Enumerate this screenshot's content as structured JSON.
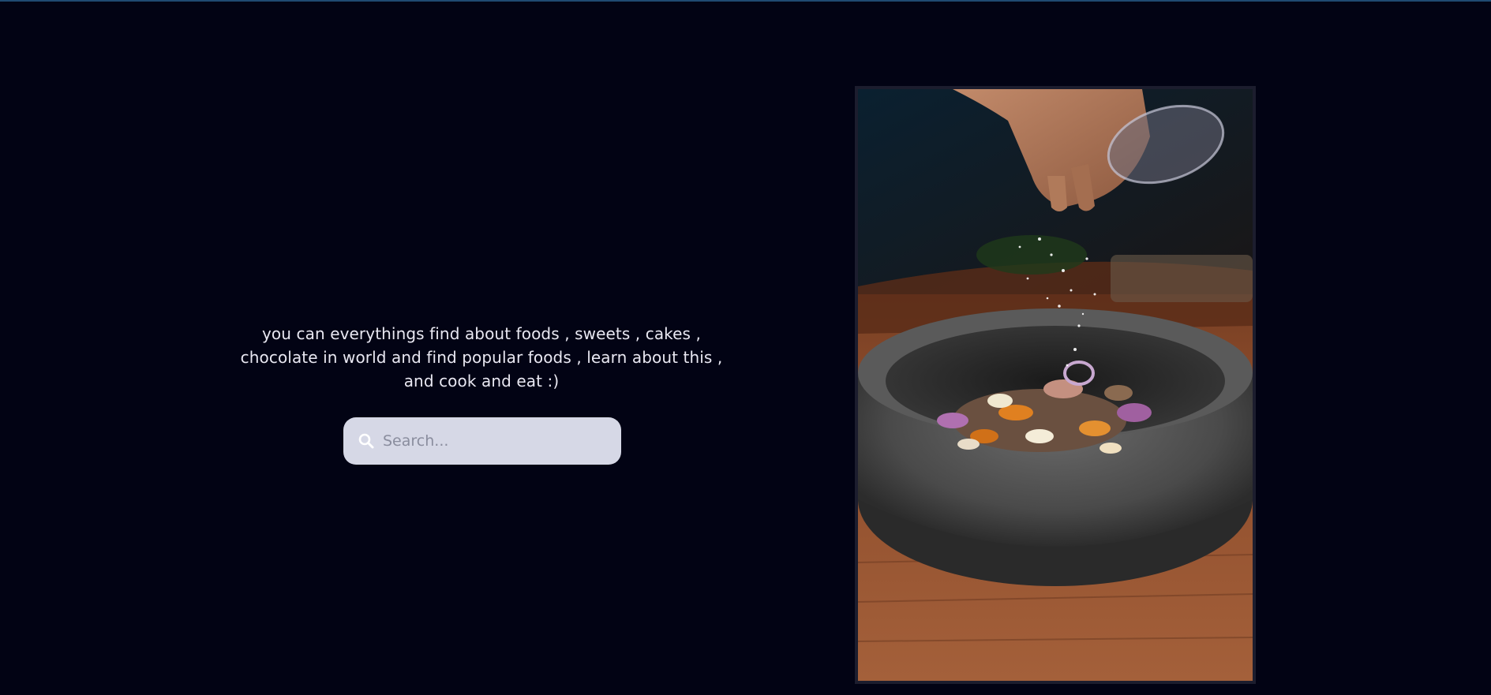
{
  "hero": {
    "description": "you can everythings find about foods , sweets , cakes , chocolate in world and find popular foods , learn about this , and cook and eat :)"
  },
  "search": {
    "placeholder": "Search...",
    "value": "",
    "icon": "search-icon"
  },
  "photo": {
    "subject": "hand sprinkling salt over chopped onions and spices in a stone mortar bowl"
  },
  "colors": {
    "background": "#020314",
    "text": "#e9e8f2",
    "search_bg": "#d6d8e6",
    "frame": "#1c1d2e",
    "top_border": "#1f4a72"
  }
}
